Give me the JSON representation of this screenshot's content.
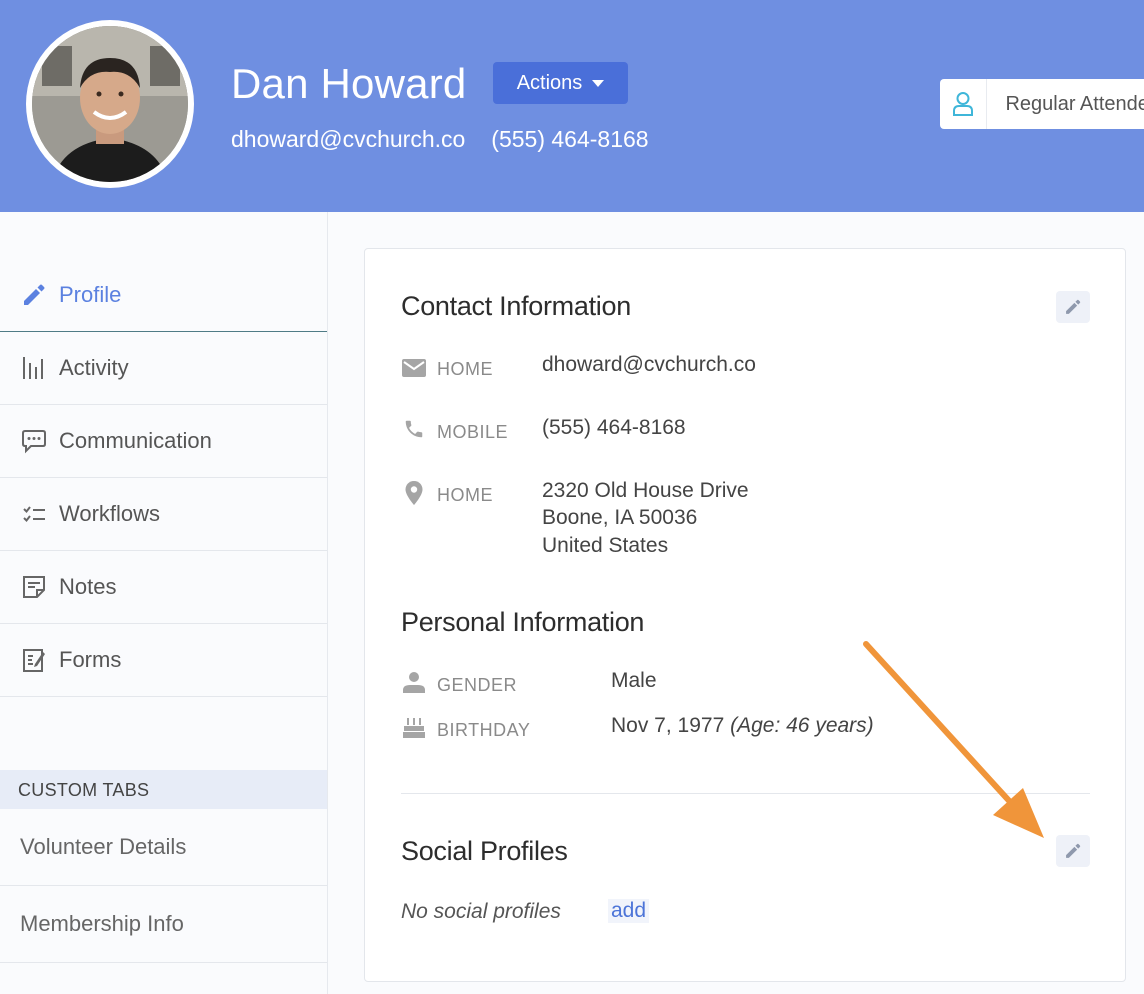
{
  "header": {
    "name": "Dan Howard",
    "actions_label": "Actions",
    "email": "dhoward@cvchurch.co",
    "phone": "(555) 464-8168",
    "status": "Regular Attendee"
  },
  "sidebar": {
    "items": [
      {
        "label": "Profile",
        "icon": "pencil-icon"
      },
      {
        "label": "Activity",
        "icon": "activity-bars-icon"
      },
      {
        "label": "Communication",
        "icon": "chat-bubble-icon"
      },
      {
        "label": "Workflows",
        "icon": "checklist-icon"
      },
      {
        "label": "Notes",
        "icon": "note-icon"
      },
      {
        "label": "Forms",
        "icon": "form-icon"
      }
    ],
    "custom_tabs_header": "CUSTOM TABS",
    "custom_tabs": [
      "Volunteer Details",
      "Membership Info"
    ]
  },
  "contact": {
    "title": "Contact Information",
    "rows": [
      {
        "icon": "envelope-icon",
        "label": "HOME",
        "value": "dhoward@cvchurch.co"
      },
      {
        "icon": "phone-icon",
        "label": "MOBILE",
        "value": "(555) 464-8168"
      },
      {
        "icon": "location-pin-icon",
        "label": "HOME",
        "lines": [
          "2320 Old House Drive",
          "Boone, IA 50036",
          "United States"
        ]
      }
    ]
  },
  "personal": {
    "title": "Personal Information",
    "gender_label": "GENDER",
    "gender_value": "Male",
    "birthday_label": "BIRTHDAY",
    "birthday_value": "Nov 7, 1977",
    "birthday_age": "(Age: 46 years)"
  },
  "social": {
    "title": "Social Profiles",
    "empty_text": "No social profiles",
    "add_label": "add"
  },
  "colors": {
    "header_bg": "#6f8fe1",
    "accent": "#5b81e0",
    "actions_bg": "#4a6fd9",
    "annotation_arrow": "#f0953a"
  }
}
